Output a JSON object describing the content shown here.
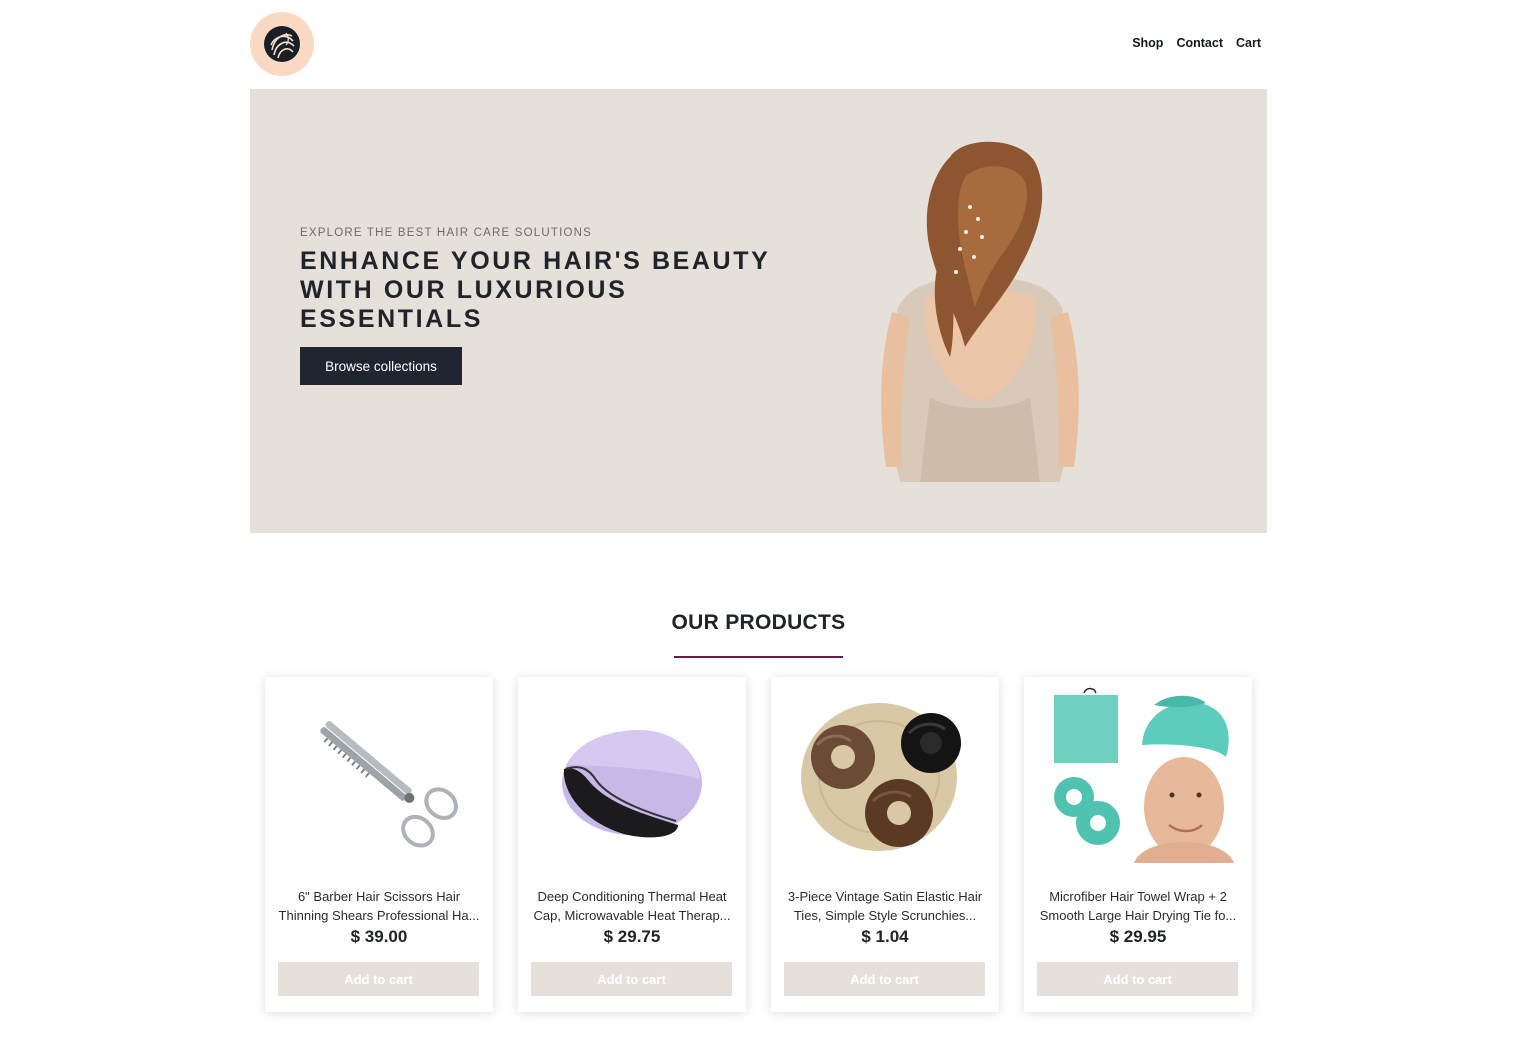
{
  "header": {
    "logo_alt": "brand-logo",
    "nav": [
      {
        "label": "Shop"
      },
      {
        "label": "Contact"
      },
      {
        "label": "Cart"
      }
    ]
  },
  "hero": {
    "eyebrow": "EXPLORE THE BEST HAIR CARE SOLUTIONS",
    "title": "ENHANCE YOUR HAIR'S BEAUTY WITH OUR LUXURIOUS ESSENTIALS",
    "button_label": "Browse collections",
    "background": "#e5e0da"
  },
  "products_section": {
    "title": "OUR PRODUCTS",
    "underline_color": "#6d1a4d",
    "items": [
      {
        "name": "6\" Barber Hair Scissors Hair Thinning Shears Professional Ha...",
        "price": "$ 39.00",
        "button_label": "Add to cart",
        "image": "thinning-shears-image"
      },
      {
        "name": "Deep Conditioning Thermal Heat Cap, Microwavable Heat Therap...",
        "price": "$ 29.75",
        "button_label": "Add to cart",
        "image": "thermal-heat-cap-image"
      },
      {
        "name": "3-Piece Vintage Satin Elastic Hair Ties, Simple Style Scrunchies...",
        "price": "$ 1.04",
        "button_label": "Add to cart",
        "image": "satin-scrunchies-image"
      },
      {
        "name": "Microfiber Hair Towel Wrap + 2 Smooth Large Hair Drying Tie fo...",
        "price": "$ 29.95",
        "button_label": "Add to cart",
        "image": "hair-towel-wrap-image"
      }
    ]
  },
  "colors": {
    "dark": "#1f2531",
    "accent": "#6d1a4d",
    "logo_bg": "#f9d9c4",
    "neutral": "#e5e0da"
  }
}
